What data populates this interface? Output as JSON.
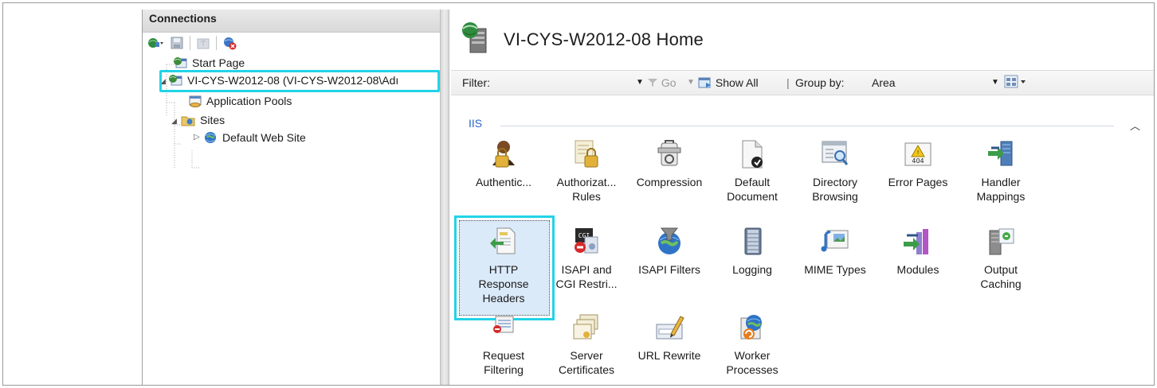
{
  "connections": {
    "header": "Connections",
    "toolbar": [
      {
        "name": "connect-icon"
      },
      {
        "name": "save-icon"
      },
      {
        "name": "up-icon"
      },
      {
        "name": "disconnect-icon"
      }
    ],
    "tree": {
      "start_page": "Start Page",
      "server": "VI-CYS-W2012-08 (VI-CYS-W2012-08\\Adı",
      "app_pools": "Application Pools",
      "sites": "Sites",
      "default_site": "Default Web Site"
    }
  },
  "home": {
    "title": "VI-CYS-W2012-08 Home",
    "filter_label": "Filter:",
    "go_label": "Go",
    "show_all_label": "Show All",
    "group_by_label": "Group by:",
    "group_by_value": "Area",
    "group_name": "IIS",
    "features": [
      {
        "label1": "Authentic...",
        "label2": "",
        "icon": "authentication-icon"
      },
      {
        "label1": "Authorizat...",
        "label2": "Rules",
        "icon": "authorization-rules-icon"
      },
      {
        "label1": "Compression",
        "label2": "",
        "icon": "compression-icon"
      },
      {
        "label1": "Default",
        "label2": "Document",
        "icon": "default-document-icon"
      },
      {
        "label1": "Directory",
        "label2": "Browsing",
        "icon": "directory-browsing-icon"
      },
      {
        "label1": "Error Pages",
        "label2": "",
        "icon": "error-pages-icon",
        "badge": "404"
      },
      {
        "label1": "Handler",
        "label2": "Mappings",
        "icon": "handler-mappings-icon"
      },
      {
        "label1": "HTTP",
        "label2": "Response",
        "label3": "Headers",
        "icon": "http-response-headers-icon"
      },
      {
        "label1": "ISAPI and",
        "label2": "CGI Restri...",
        "icon": "isapi-cgi-icon",
        "badge": "CGI"
      },
      {
        "label1": "ISAPI Filters",
        "label2": "",
        "icon": "isapi-filters-icon"
      },
      {
        "label1": "Logging",
        "label2": "",
        "icon": "logging-icon"
      },
      {
        "label1": "MIME Types",
        "label2": "",
        "icon": "mime-types-icon"
      },
      {
        "label1": "Modules",
        "label2": "",
        "icon": "modules-icon"
      },
      {
        "label1": "Output",
        "label2": "Caching",
        "icon": "output-caching-icon"
      },
      {
        "label1": "Request",
        "label2": "Filtering",
        "icon": "request-filtering-icon"
      },
      {
        "label1": "Server",
        "label2": "Certificates",
        "icon": "server-certificates-icon"
      },
      {
        "label1": "URL Rewrite",
        "label2": "",
        "icon": "url-rewrite-icon"
      },
      {
        "label1": "Worker",
        "label2": "Processes",
        "icon": "worker-processes-icon"
      }
    ]
  }
}
